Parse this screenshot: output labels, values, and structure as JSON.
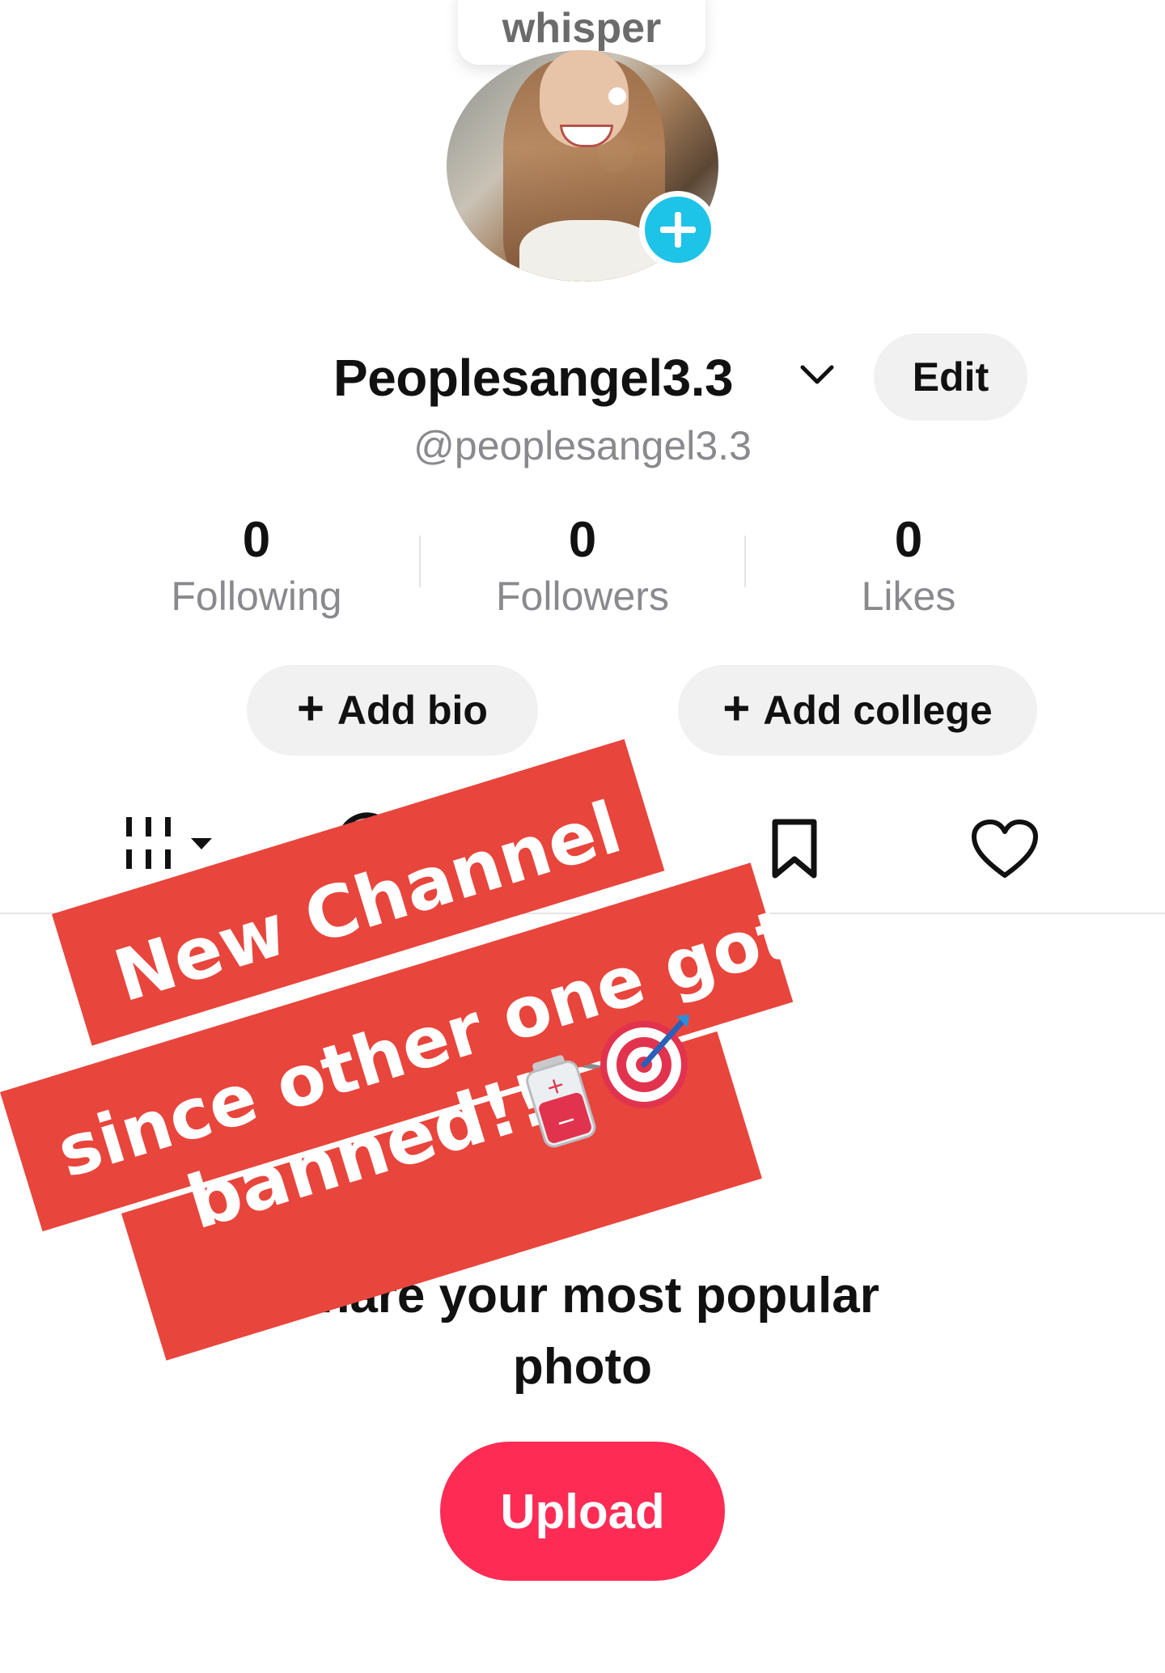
{
  "whisper_label": "whisper",
  "profile": {
    "display_name": "Peoplesangel3.3",
    "handle": "@peoplesangel3.3",
    "edit_label": "Edit"
  },
  "stats": [
    {
      "value": "0",
      "label": "Following"
    },
    {
      "value": "0",
      "label": "Followers"
    },
    {
      "value": "0",
      "label": "Likes"
    }
  ],
  "actions": {
    "add_bio": "Add bio",
    "add_college": "Add college"
  },
  "tabs": [
    {
      "icon": "grid-icon"
    },
    {
      "icon": "repost-icon"
    },
    {
      "icon": "bookmark-icon"
    },
    {
      "icon": "heart-icon"
    }
  ],
  "empty_state": {
    "title_line1": "Share your most popular",
    "title_line2": "photo",
    "upload_label": "Upload"
  },
  "overlay_caption": {
    "line1": "New Channel",
    "line2": "since other one got",
    "line3": "banned!!",
    "emojis": [
      "battery-icon",
      "target-icon"
    ]
  },
  "colors": {
    "accent_blue": "#1ec3e8",
    "upload_red": "#fe2c55",
    "sticker_red": "#e8453c"
  }
}
